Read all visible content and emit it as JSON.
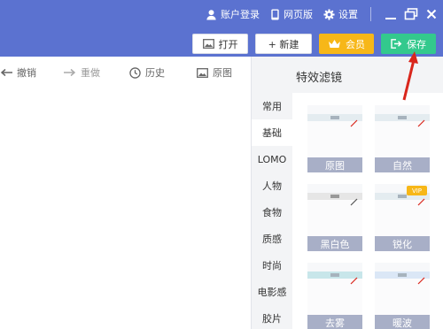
{
  "header": {
    "account_login": "账户登录",
    "web_version": "网页版",
    "settings": "设置"
  },
  "actions": {
    "open": "打开",
    "new": "+ 新建",
    "vip": "会员",
    "save": "保存"
  },
  "toolbar": {
    "undo": "撤销",
    "redo": "重做",
    "history": "历史",
    "original": "原图"
  },
  "panel": {
    "title": "特效滤镜",
    "categories": [
      "常用",
      "基础",
      "LOMO",
      "人物",
      "食物",
      "质感",
      "时尚",
      "电影感",
      "胶片"
    ],
    "active_category": "基础",
    "filters": [
      "原图",
      "自然",
      "黑白色",
      "锐化",
      "去雾",
      "暖波"
    ],
    "vip_tag": "VIP"
  },
  "colors": {
    "header_bg": "#5b72d0",
    "vip": "#f7b718",
    "save": "#33c98d",
    "arrow": "#d9261c"
  }
}
